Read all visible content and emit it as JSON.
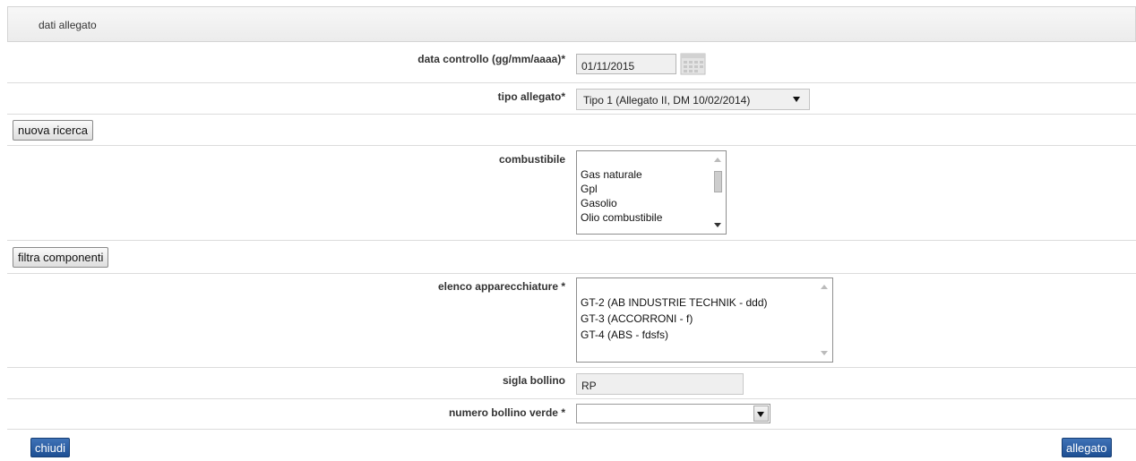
{
  "section": {
    "title": "dati allegato"
  },
  "data_controllo": {
    "label": "data controllo (gg/mm/aaaa)*",
    "value": "01/11/2015"
  },
  "tipo_allegato": {
    "label": "tipo allegato*",
    "value": "Tipo 1 (Allegato II, DM 10/02/2014)"
  },
  "buttons": {
    "nuova_ricerca": "nuova ricerca",
    "filtra_componenti": "filtra componenti",
    "chiudi": "chiudi",
    "allegato": "allegato"
  },
  "combustibile": {
    "label": "combustibile",
    "options": [
      "Gas naturale",
      "Gpl",
      "Gasolio",
      "Olio combustibile"
    ]
  },
  "elenco_apparecchiature": {
    "label": "elenco apparecchiature *",
    "options": [
      "GT-2 (AB INDUSTRIE TECHNIK - ddd)",
      "GT-3 (ACCORRONI - f)",
      "GT-4 (ABS - fdsfs)"
    ]
  },
  "sigla_bollino": {
    "label": "sigla bollino",
    "value": "RP"
  },
  "numero_bollino_verde": {
    "label": "numero bollino verde *",
    "value": ""
  },
  "icons": {
    "calendar": "calendar-icon",
    "dropdown": "chevron-down-icon"
  },
  "colors": {
    "primary_button": "#2a5ea6",
    "header_bg": "#f0f0f0",
    "field_bg": "#f0f0f0"
  }
}
